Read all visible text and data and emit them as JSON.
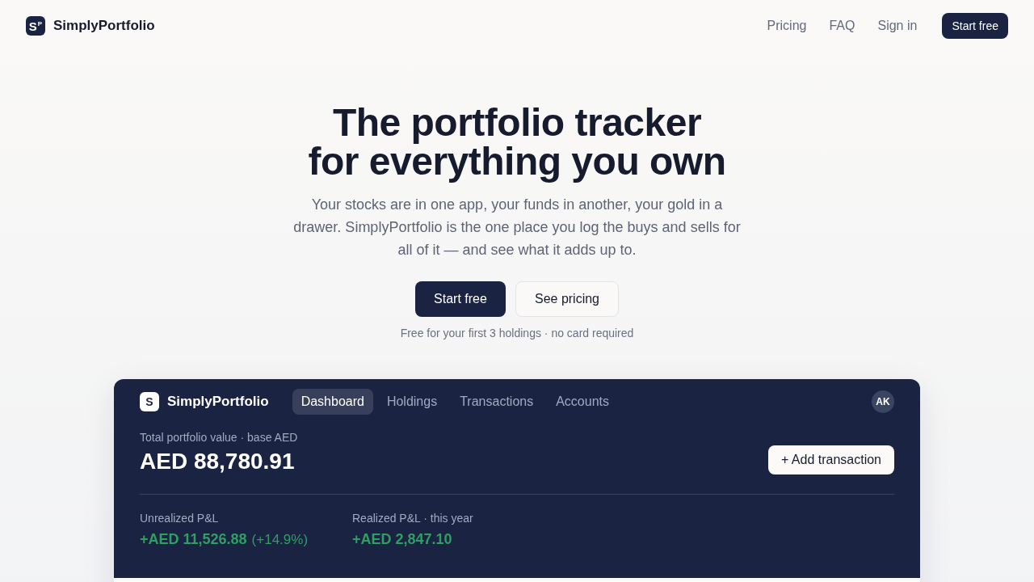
{
  "nav": {
    "brand": {
      "mark_letter": "S",
      "mark_sub": "P",
      "name": "SimplyPortfolio"
    },
    "links": [
      {
        "label": "Pricing"
      },
      {
        "label": "FAQ"
      },
      {
        "label": "Sign in"
      }
    ],
    "cta": "Start free"
  },
  "hero": {
    "title_lines": [
      "The portfolio tracker",
      "for everything you own"
    ],
    "subtitle": "Your stocks are in one app, your funds in another, your gold in a drawer. SimplyPortfolio is the one place you log the buys and sells for all of it — and see what it adds up to.",
    "buttons": [
      {
        "label": "Start free",
        "kind": "primary"
      },
      {
        "label": "See pricing",
        "kind": "secondary"
      }
    ],
    "note": "Free for your first 3 holdings · no card required"
  },
  "app_preview": {
    "brand": {
      "mark_letter": "S",
      "name": "SimplyPortfolio"
    },
    "tabs": [
      {
        "label": "Dashboard",
        "selected": true
      },
      {
        "label": "Holdings",
        "selected": false
      },
      {
        "label": "Transactions",
        "selected": false
      },
      {
        "label": "Accounts",
        "selected": false
      }
    ],
    "avatar": "AK",
    "total": {
      "label": "Total portfolio value · base AED",
      "value": "AED 88,780.91"
    },
    "add_button": "+ Add transaction",
    "stats": [
      {
        "label": "Unrealized P&L",
        "value": "+AED 11,526.88",
        "change": "(+14.9%)"
      },
      {
        "label": "Realized P&L · this year",
        "value": "+AED 2,847.10"
      }
    ]
  }
}
